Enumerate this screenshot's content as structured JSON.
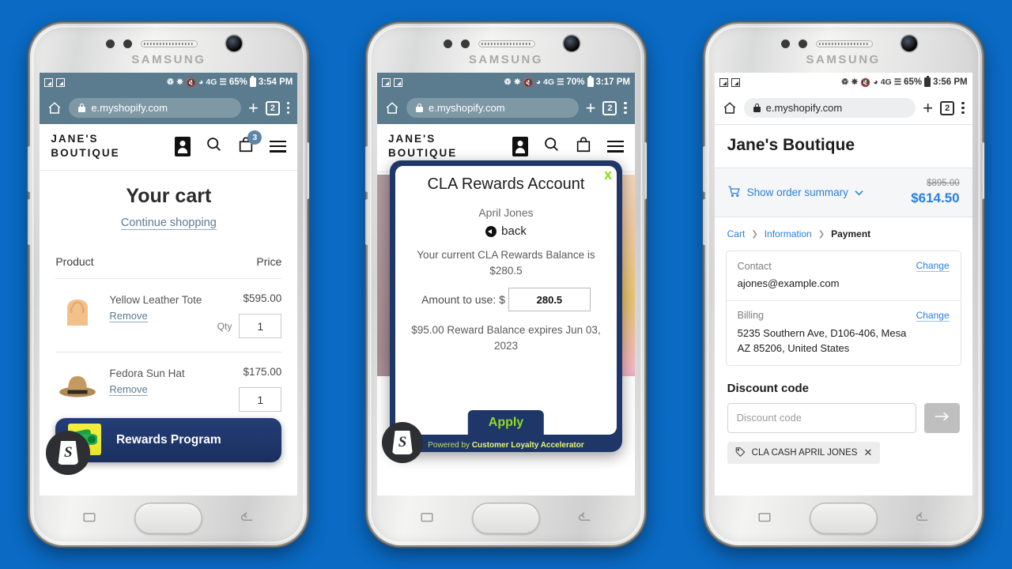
{
  "background_color": "#0a6ac4",
  "phones": [
    {
      "device_brand": "SAMSUNG",
      "status_bar": {
        "battery": "65%",
        "time": "3:54 PM",
        "network": "4G",
        "theme": "dark"
      },
      "browser": {
        "url": "e.myshopify.com",
        "tab_count": "2",
        "new_tab_label": "+"
      },
      "store": {
        "logo_line1": "JANE'S",
        "logo_line2": "BOUTIQUE",
        "cart_badge": "3"
      },
      "cart": {
        "title": "Your cart",
        "continue_shopping": "Continue shopping",
        "col_product": "Product",
        "col_price": "Price",
        "qty_label": "Qty",
        "remove_label": "Remove",
        "items": [
          {
            "name": "Yellow Leather Tote",
            "price": "$595.00",
            "qty": "1",
            "thumb": "tote-bag"
          },
          {
            "name": "Fedora Sun Hat",
            "price": "$175.00",
            "qty": "1",
            "thumb": "fedora-hat"
          }
        ]
      },
      "rewards_banner": {
        "label": "Rewards Program",
        "icon": "money-icon",
        "badge": "shopify-logo"
      }
    },
    {
      "device_brand": "SAMSUNG",
      "status_bar": {
        "battery": "70%",
        "time": "3:17 PM",
        "network": "4G",
        "theme": "dark"
      },
      "browser": {
        "url": "e.myshopify.com",
        "tab_count": "2",
        "new_tab_label": "+"
      },
      "store": {
        "logo_line1": "JANE'S",
        "logo_line2": "BOUTIQUE"
      },
      "modal": {
        "title": "CLA Rewards Account",
        "close_label": "x",
        "customer_name": "April Jones",
        "back_label": "back",
        "balance_text": "Your current CLA Rewards Balance is $280.5",
        "amount_label": "Amount to use: $",
        "amount_value": "280.5",
        "expiry_text": "$95.00 Reward Balance expires Jun 03, 2023",
        "apply_label": "Apply",
        "powered_prefix": "Powered by ",
        "powered_brand": "Customer Loyalty Accelerator"
      }
    },
    {
      "device_brand": "SAMSUNG",
      "status_bar": {
        "battery": "65%",
        "time": "3:56 PM",
        "network": "4G",
        "theme": "light"
      },
      "browser": {
        "url": "e.myshopify.com",
        "tab_count": "2",
        "new_tab_label": "+"
      },
      "checkout": {
        "store_name": "Jane's Boutique",
        "show_order_summary": "Show order summary",
        "price_original": "$895.00",
        "price_current": "$614.50",
        "breadcrumb": {
          "cart": "Cart",
          "information": "Information",
          "payment": "Payment"
        },
        "contact_label": "Contact",
        "contact_value": "ajones@example.com",
        "contact_change": "Change",
        "billing_label": "Billing",
        "billing_line1": "5235 Southern Ave, D106-406, Mesa",
        "billing_line2": "AZ 85206, United States",
        "billing_change": "Change",
        "discount_title": "Discount code",
        "discount_placeholder": "Discount code",
        "discount_value": "",
        "applied_tag": "CLA CASH APRIL JONES"
      }
    }
  ]
}
